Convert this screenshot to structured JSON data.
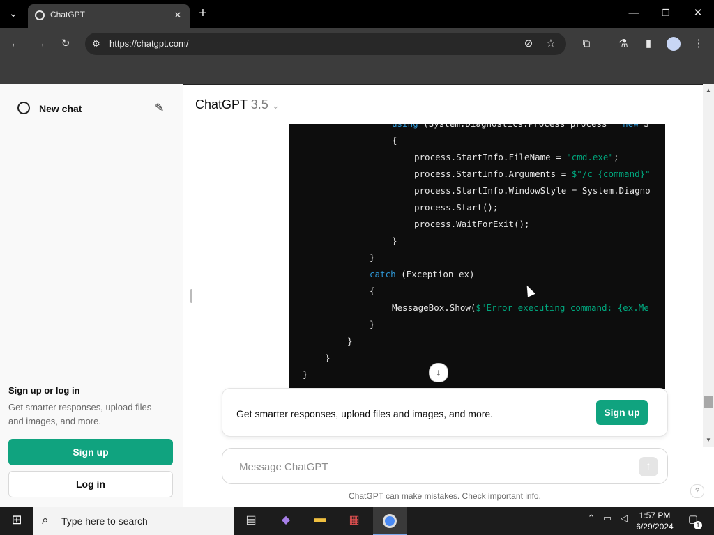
{
  "browser": {
    "tab_title": "ChatGPT",
    "url": "https://chatgpt.com/"
  },
  "sidebar": {
    "new_chat_label": "New chat",
    "signup_title": "Sign up or log in",
    "signup_desc": "Get smarter responses, upload files and images, and more.",
    "signup_button": "Sign up",
    "login_button": "Log in"
  },
  "header": {
    "model_name": "ChatGPT",
    "model_version": "3.5"
  },
  "code_block": {
    "lines": [
      {
        "indent": 4,
        "text": "using (System.Diagnostics.Process process = new S"
      },
      {
        "indent": 4,
        "text": "{"
      },
      {
        "indent": 5,
        "text": "process.StartInfo.FileName = \"cmd.exe\";"
      },
      {
        "indent": 5,
        "text": "process.StartInfo.Arguments = $\"/c {command}\""
      },
      {
        "indent": 5,
        "text": "process.StartInfo.WindowStyle = System.Diagno"
      },
      {
        "indent": 5,
        "text": "process.Start();"
      },
      {
        "indent": 5,
        "text": "process.WaitForExit();"
      },
      {
        "indent": 4,
        "text": "}"
      },
      {
        "indent": 3,
        "text": "}"
      },
      {
        "indent": 3,
        "text": "catch (Exception ex)"
      },
      {
        "indent": 3,
        "text": "{"
      },
      {
        "indent": 4,
        "text": "MessageBox.Show($\"Error executing command: {ex.Me"
      },
      {
        "indent": 3,
        "text": "}"
      },
      {
        "indent": 2,
        "text": "}"
      },
      {
        "indent": 1,
        "text": "}"
      },
      {
        "indent": 0,
        "text": "}"
      }
    ]
  },
  "banner": {
    "text": "Get smarter responses, upload files and images, and more.",
    "button": "Sign up"
  },
  "composer": {
    "placeholder": "Message ChatGPT"
  },
  "disclaimer": "ChatGPT can make mistakes. Check important info.",
  "taskbar": {
    "search_placeholder": "Type here to search",
    "time": "1:57 PM",
    "date": "6/29/2024",
    "notification_count": "1"
  },
  "colors": {
    "accent": "#10a37f",
    "code_bg": "#0d0d0d",
    "keyword": "#2e95d3",
    "string": "#00a67d"
  }
}
